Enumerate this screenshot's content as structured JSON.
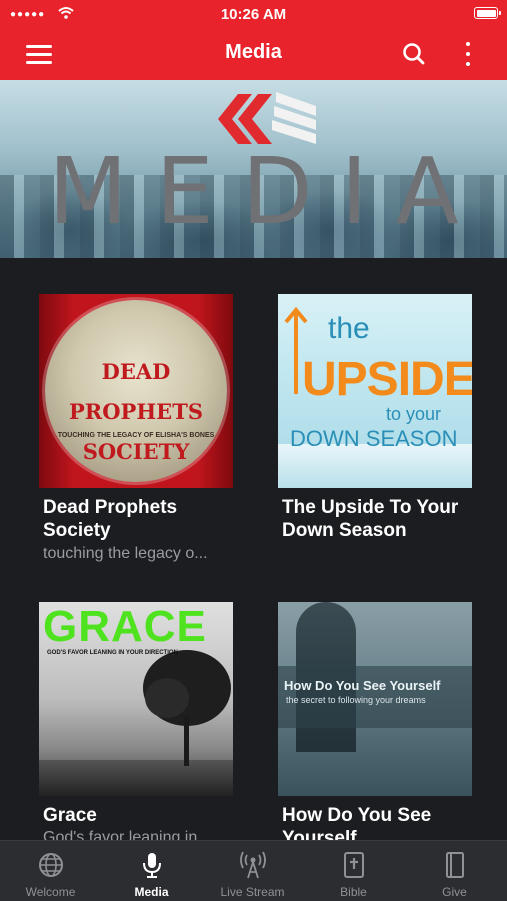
{
  "status_bar": {
    "signal": "●●●●●",
    "time": "10:26 AM"
  },
  "app_bar": {
    "title": "Media"
  },
  "banner": {
    "title": "MEDIA"
  },
  "cards": [
    {
      "title": "Dead Prophets Society",
      "subtitle": "touching the legacy o...",
      "art_title": "DEAD PROPHETS SOCIETY",
      "art_subtitle": "TOUCHING THE LEGACY OF ELISHA'S BONES"
    },
    {
      "title": "The Upside To Your Down Season",
      "subtitle": "",
      "art_line1": "the",
      "art_line2": "UPSIDE",
      "art_line3": "to your",
      "art_line4": "DOWN SEASON"
    },
    {
      "title": "Grace",
      "subtitle": "God's favor leaning in...",
      "art_title": "GRACE",
      "art_subtitle": "GOD'S FAVOR LEANING IN YOUR DIRECTION"
    },
    {
      "title": "How Do You See Yourself",
      "subtitle": "",
      "art_title": "How Do You See Yourself",
      "art_subtitle": "the secret to following your dreams"
    }
  ],
  "tabs": [
    {
      "label": "Welcome",
      "icon": "globe-icon"
    },
    {
      "label": "Media",
      "icon": "microphone-icon"
    },
    {
      "label": "Live Stream",
      "icon": "broadcast-icon"
    },
    {
      "label": "Bible",
      "icon": "bible-icon"
    },
    {
      "label": "Give",
      "icon": "give-icon"
    }
  ],
  "colors": {
    "accent": "#e8232b",
    "background": "#1c1d20",
    "tab_bar": "#2c2d30"
  }
}
